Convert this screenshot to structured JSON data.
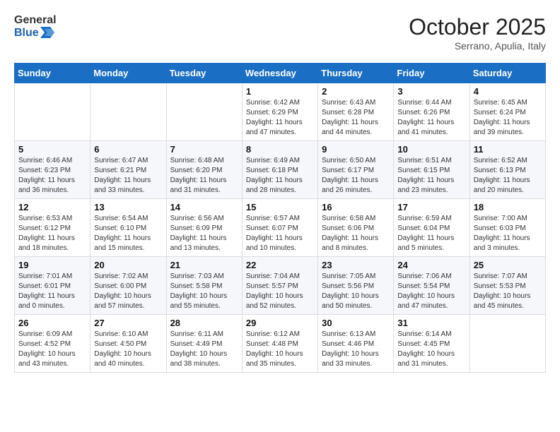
{
  "header": {
    "logo_general": "General",
    "logo_blue": "Blue",
    "month": "October 2025",
    "location": "Serrano, Apulia, Italy"
  },
  "weekdays": [
    "Sunday",
    "Monday",
    "Tuesday",
    "Wednesday",
    "Thursday",
    "Friday",
    "Saturday"
  ],
  "weeks": [
    [
      {
        "day": "",
        "info": ""
      },
      {
        "day": "",
        "info": ""
      },
      {
        "day": "",
        "info": ""
      },
      {
        "day": "1",
        "info": "Sunrise: 6:42 AM\nSunset: 6:29 PM\nDaylight: 11 hours\nand 47 minutes."
      },
      {
        "day": "2",
        "info": "Sunrise: 6:43 AM\nSunset: 6:28 PM\nDaylight: 11 hours\nand 44 minutes."
      },
      {
        "day": "3",
        "info": "Sunrise: 6:44 AM\nSunset: 6:26 PM\nDaylight: 11 hours\nand 41 minutes."
      },
      {
        "day": "4",
        "info": "Sunrise: 6:45 AM\nSunset: 6:24 PM\nDaylight: 11 hours\nand 39 minutes."
      }
    ],
    [
      {
        "day": "5",
        "info": "Sunrise: 6:46 AM\nSunset: 6:23 PM\nDaylight: 11 hours\nand 36 minutes."
      },
      {
        "day": "6",
        "info": "Sunrise: 6:47 AM\nSunset: 6:21 PM\nDaylight: 11 hours\nand 33 minutes."
      },
      {
        "day": "7",
        "info": "Sunrise: 6:48 AM\nSunset: 6:20 PM\nDaylight: 11 hours\nand 31 minutes."
      },
      {
        "day": "8",
        "info": "Sunrise: 6:49 AM\nSunset: 6:18 PM\nDaylight: 11 hours\nand 28 minutes."
      },
      {
        "day": "9",
        "info": "Sunrise: 6:50 AM\nSunset: 6:17 PM\nDaylight: 11 hours\nand 26 minutes."
      },
      {
        "day": "10",
        "info": "Sunrise: 6:51 AM\nSunset: 6:15 PM\nDaylight: 11 hours\nand 23 minutes."
      },
      {
        "day": "11",
        "info": "Sunrise: 6:52 AM\nSunset: 6:13 PM\nDaylight: 11 hours\nand 20 minutes."
      }
    ],
    [
      {
        "day": "12",
        "info": "Sunrise: 6:53 AM\nSunset: 6:12 PM\nDaylight: 11 hours\nand 18 minutes."
      },
      {
        "day": "13",
        "info": "Sunrise: 6:54 AM\nSunset: 6:10 PM\nDaylight: 11 hours\nand 15 minutes."
      },
      {
        "day": "14",
        "info": "Sunrise: 6:56 AM\nSunset: 6:09 PM\nDaylight: 11 hours\nand 13 minutes."
      },
      {
        "day": "15",
        "info": "Sunrise: 6:57 AM\nSunset: 6:07 PM\nDaylight: 11 hours\nand 10 minutes."
      },
      {
        "day": "16",
        "info": "Sunrise: 6:58 AM\nSunset: 6:06 PM\nDaylight: 11 hours\nand 8 minutes."
      },
      {
        "day": "17",
        "info": "Sunrise: 6:59 AM\nSunset: 6:04 PM\nDaylight: 11 hours\nand 5 minutes."
      },
      {
        "day": "18",
        "info": "Sunrise: 7:00 AM\nSunset: 6:03 PM\nDaylight: 11 hours\nand 3 minutes."
      }
    ],
    [
      {
        "day": "19",
        "info": "Sunrise: 7:01 AM\nSunset: 6:01 PM\nDaylight: 11 hours\nand 0 minutes."
      },
      {
        "day": "20",
        "info": "Sunrise: 7:02 AM\nSunset: 6:00 PM\nDaylight: 10 hours\nand 57 minutes."
      },
      {
        "day": "21",
        "info": "Sunrise: 7:03 AM\nSunset: 5:58 PM\nDaylight: 10 hours\nand 55 minutes."
      },
      {
        "day": "22",
        "info": "Sunrise: 7:04 AM\nSunset: 5:57 PM\nDaylight: 10 hours\nand 52 minutes."
      },
      {
        "day": "23",
        "info": "Sunrise: 7:05 AM\nSunset: 5:56 PM\nDaylight: 10 hours\nand 50 minutes."
      },
      {
        "day": "24",
        "info": "Sunrise: 7:06 AM\nSunset: 5:54 PM\nDaylight: 10 hours\nand 47 minutes."
      },
      {
        "day": "25",
        "info": "Sunrise: 7:07 AM\nSunset: 5:53 PM\nDaylight: 10 hours\nand 45 minutes."
      }
    ],
    [
      {
        "day": "26",
        "info": "Sunrise: 6:09 AM\nSunset: 4:52 PM\nDaylight: 10 hours\nand 43 minutes."
      },
      {
        "day": "27",
        "info": "Sunrise: 6:10 AM\nSunset: 4:50 PM\nDaylight: 10 hours\nand 40 minutes."
      },
      {
        "day": "28",
        "info": "Sunrise: 6:11 AM\nSunset: 4:49 PM\nDaylight: 10 hours\nand 38 minutes."
      },
      {
        "day": "29",
        "info": "Sunrise: 6:12 AM\nSunset: 4:48 PM\nDaylight: 10 hours\nand 35 minutes."
      },
      {
        "day": "30",
        "info": "Sunrise: 6:13 AM\nSunset: 4:46 PM\nDaylight: 10 hours\nand 33 minutes."
      },
      {
        "day": "31",
        "info": "Sunrise: 6:14 AM\nSunset: 4:45 PM\nDaylight: 10 hours\nand 31 minutes."
      },
      {
        "day": "",
        "info": ""
      }
    ]
  ]
}
